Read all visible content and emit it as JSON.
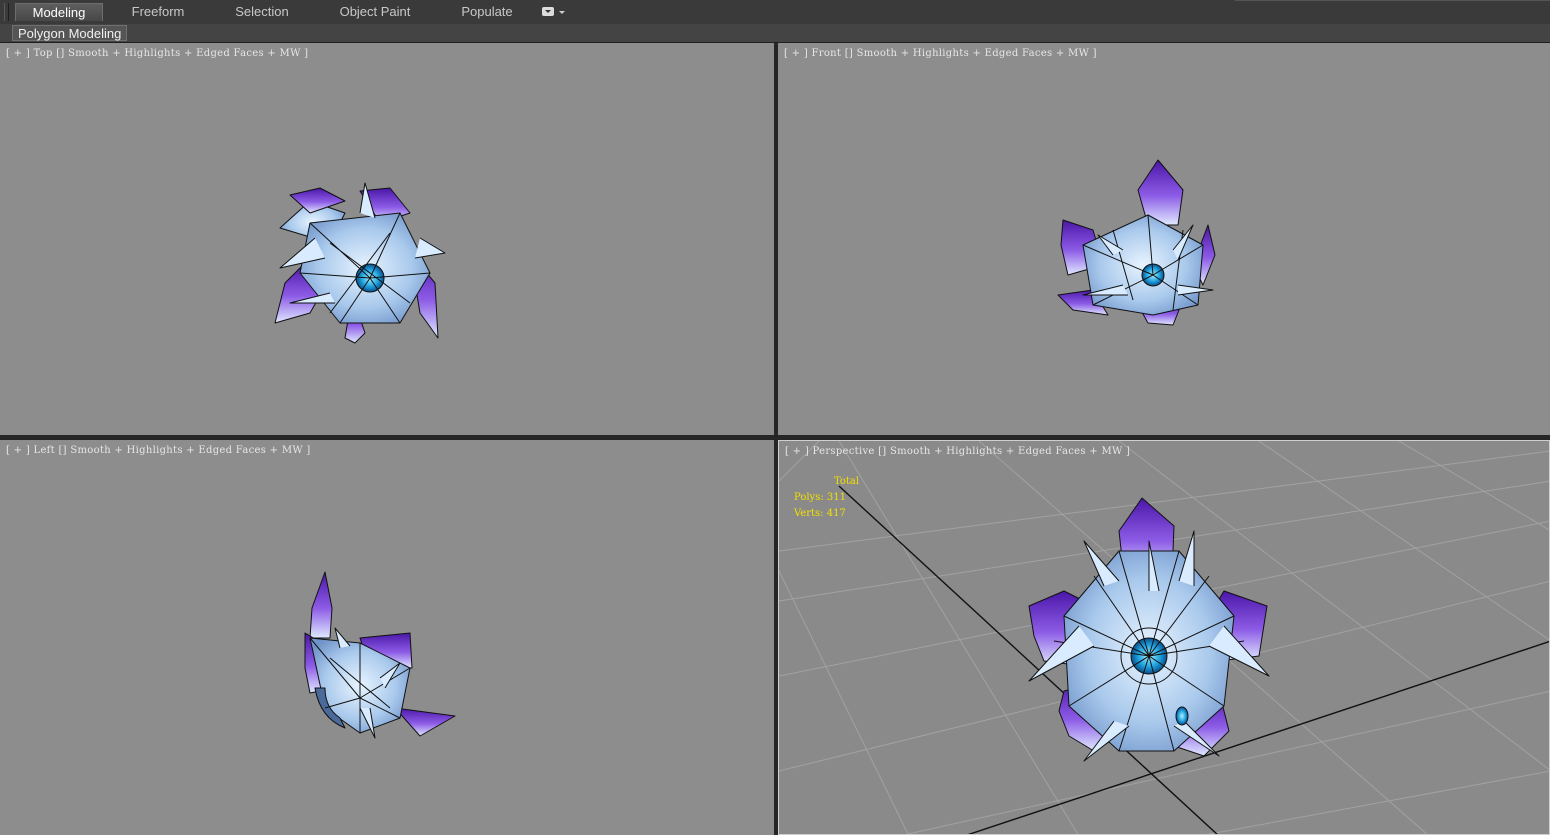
{
  "ribbon": {
    "tabs": [
      {
        "label": "Modeling",
        "active": true
      },
      {
        "label": "Freeform",
        "active": false
      },
      {
        "label": "Selection",
        "active": false
      },
      {
        "label": "Object Paint",
        "active": false
      },
      {
        "label": "Populate",
        "active": false
      }
    ],
    "dropdown_icon": "panel-options-icon"
  },
  "subpanel": {
    "label": "Polygon Modeling"
  },
  "viewports": {
    "top": {
      "label": "[ + ] Top [] Smooth + Highlights + Edged Faces + MW ]"
    },
    "front": {
      "label": "[ + ] Front [] Smooth + Highlights + Edged Faces + MW ]"
    },
    "left": {
      "label": "[ + ] Left [] Smooth + Highlights + Edged Faces + MW ]"
    },
    "perspective": {
      "label": "[ + ] Perspective [] Smooth + Highlights + Edged Faces + MW ]",
      "stats": {
        "heading": "Total",
        "polys": "Polys: 311",
        "verts": "Verts: 417"
      }
    }
  },
  "colors": {
    "viewport_bg": "#8d8d8d",
    "stats_text": "#f2e000",
    "petal_ice": "#bcd8f2",
    "petal_violet": "#6a2fd0",
    "core_cyan": "#1fa3e0"
  }
}
